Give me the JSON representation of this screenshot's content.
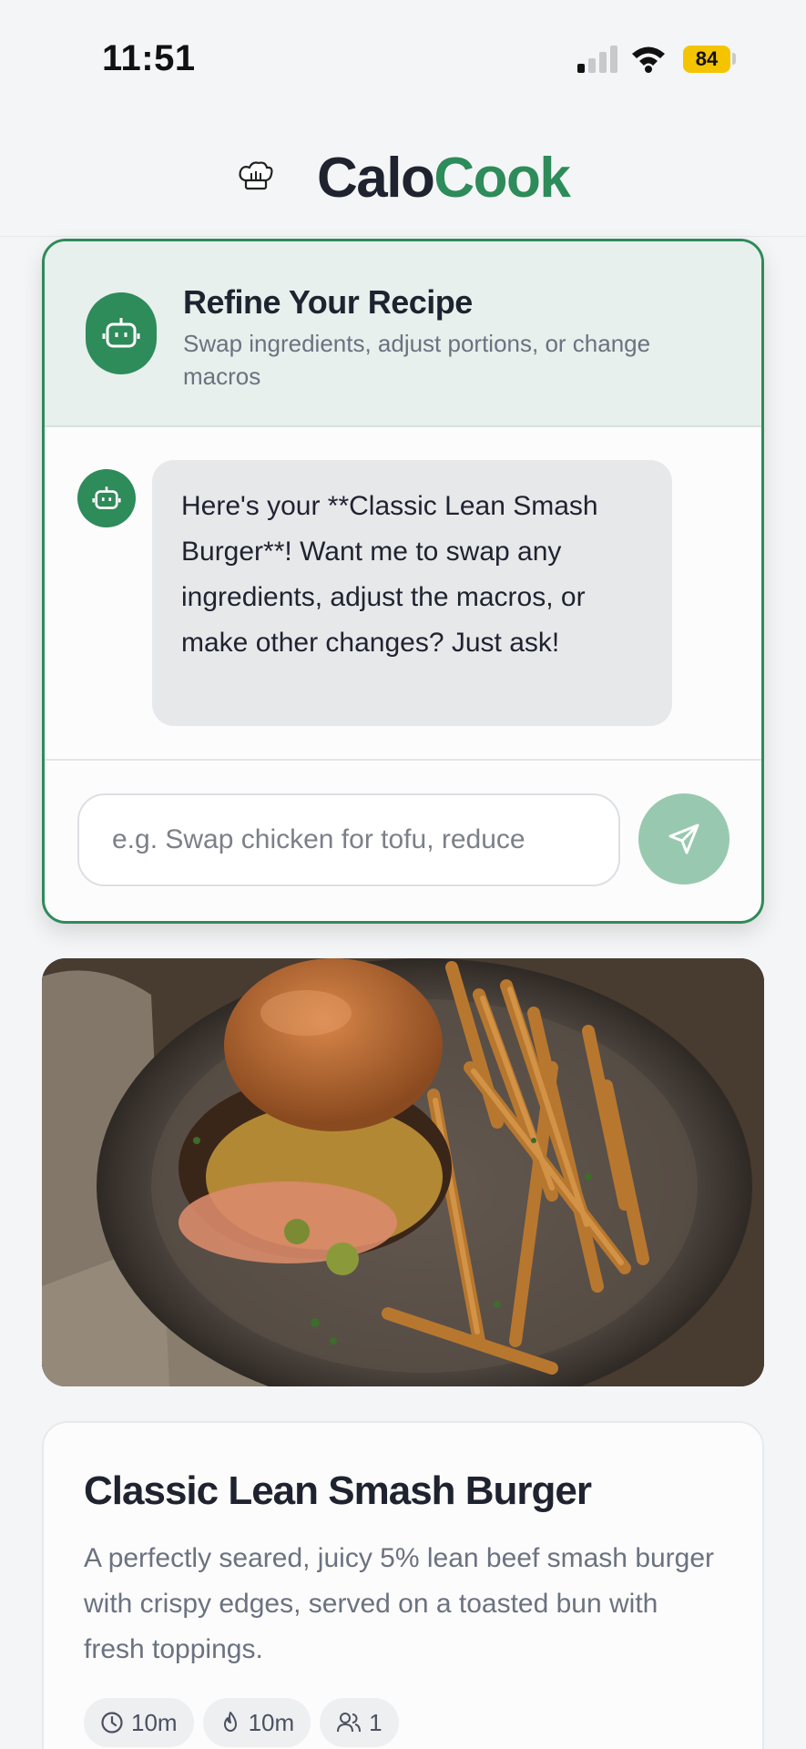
{
  "status_bar": {
    "time": "11:51",
    "battery": "84"
  },
  "header": {
    "brand_part1": "Calo",
    "brand_part2": "Cook",
    "brand_icon": "chef-hat-icon",
    "brand_color": "#2e8b5a"
  },
  "refine": {
    "title": "Refine Your Recipe",
    "subtitle": "Swap ingredients, adjust portions, or change macros",
    "avatar_icon": "robot-icon",
    "message": "Here's your **Classic Lean Smash Burger**! Want me to swap any ingredients, adjust the macros, or make other changes? Just ask!",
    "input_placeholder": "e.g. Swap chicken for tofu, reduce",
    "input_value": "",
    "send_icon": "send-icon"
  },
  "recipe": {
    "title": "Classic Lean Smash Burger",
    "description": "A perfectly seared, juicy 5% lean beef smash burger with crispy edges, served on a toasted bun with fresh toppings.",
    "chips": [
      {
        "icon": "clock-icon",
        "label": "10m"
      },
      {
        "icon": "flame-icon",
        "label": "10m"
      },
      {
        "icon": "people-icon",
        "label": "1"
      }
    ]
  },
  "colors": {
    "accent": "#2e8b5a",
    "accent_light": "#e7f0ec",
    "send_disabled": "#98c9b0",
    "battery": "#f5c400"
  }
}
